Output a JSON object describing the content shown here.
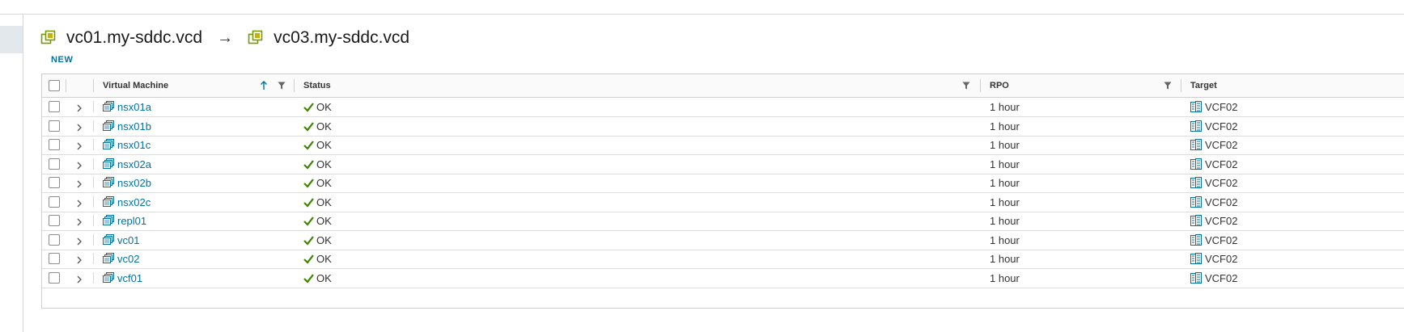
{
  "header": {
    "source": "vc01.my-sddc.vcd",
    "arrow": "→",
    "target": "vc03.my-sddc.vcd",
    "new_label": "NEW"
  },
  "table": {
    "columns": {
      "vm": "Virtual Machine",
      "status": "Status",
      "rpo": "RPO",
      "target": "Target"
    },
    "sort": "ascending",
    "rows": [
      {
        "vm": "nsx01a",
        "status": "OK",
        "rpo": "1 hour",
        "target": "VCF02"
      },
      {
        "vm": "nsx01b",
        "status": "OK",
        "rpo": "1 hour",
        "target": "VCF02"
      },
      {
        "vm": "nsx01c",
        "status": "OK",
        "rpo": "1 hour",
        "target": "VCF02"
      },
      {
        "vm": "nsx02a",
        "status": "OK",
        "rpo": "1 hour",
        "target": "VCF02"
      },
      {
        "vm": "nsx02b",
        "status": "OK",
        "rpo": "1 hour",
        "target": "VCF02"
      },
      {
        "vm": "nsx02c",
        "status": "OK",
        "rpo": "1 hour",
        "target": "VCF02"
      },
      {
        "vm": "repl01",
        "status": "OK",
        "rpo": "1 hour",
        "target": "VCF02"
      },
      {
        "vm": "vc01",
        "status": "OK",
        "rpo": "1 hour",
        "target": "VCF02"
      },
      {
        "vm": "vc02",
        "status": "OK",
        "rpo": "1 hour",
        "target": "VCF02"
      },
      {
        "vm": "vcf01",
        "status": "OK",
        "rpo": "1 hour",
        "target": "VCF02"
      }
    ]
  },
  "colors": {
    "link": "#0072a3",
    "ok": "#3c8500",
    "vc_icon": "#7a9a01"
  }
}
